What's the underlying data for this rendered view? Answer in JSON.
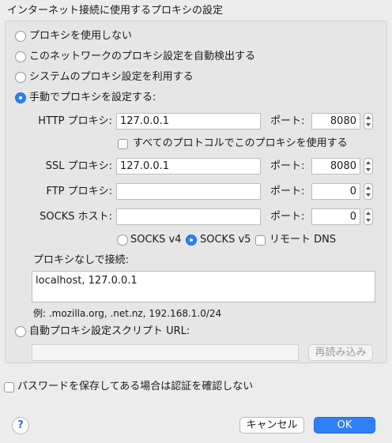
{
  "group_title": "インターネット接続に使用するプロキシの設定",
  "options": {
    "no_proxy": "プロキシを使用しない",
    "auto_detect": "このネットワークのプロキシ設定を自動検出する",
    "system": "システムのプロキシ設定を利用する",
    "manual": "手動でプロキシを設定する:",
    "selected": "manual"
  },
  "http": {
    "label": "HTTP プロキシ:",
    "host": "127.0.0.1",
    "port_label": "ポート:",
    "port": "8080"
  },
  "same_for_all": {
    "label": "すべてのプロトコルでこのプロキシを使用する",
    "checked": false
  },
  "ssl": {
    "label": "SSL プロキシ:",
    "host": "127.0.0.1",
    "port_label": "ポート:",
    "port": "8080"
  },
  "ftp": {
    "label": "FTP プロキシ:",
    "host": "",
    "port_label": "ポート:",
    "port": "0"
  },
  "socks": {
    "label": "SOCKS ホスト:",
    "host": "",
    "port_label": "ポート:",
    "port": "0"
  },
  "socks_version": {
    "v4": "SOCKS v4",
    "v5": "SOCKS v5",
    "selected": "v5",
    "remote_dns": "リモート DNS",
    "remote_dns_checked": false
  },
  "no_proxy_for": {
    "label": "プロキシなしで接続:",
    "value": "localhost, 127.0.0.1",
    "example": "例: .mozilla.org, .net.nz, 192.168.1.0/24"
  },
  "pac": {
    "label": "自動プロキシ設定スクリプト URL:",
    "value": "",
    "reload_button": "再読み込み"
  },
  "password_prompt": {
    "label": "パスワードを保存してある場合は認証を確認しない",
    "checked": false
  },
  "footer": {
    "help": "?",
    "cancel": "キャンセル",
    "ok": "OK"
  },
  "colors": {
    "accent": "#2f80f5",
    "background": "#ececec"
  }
}
